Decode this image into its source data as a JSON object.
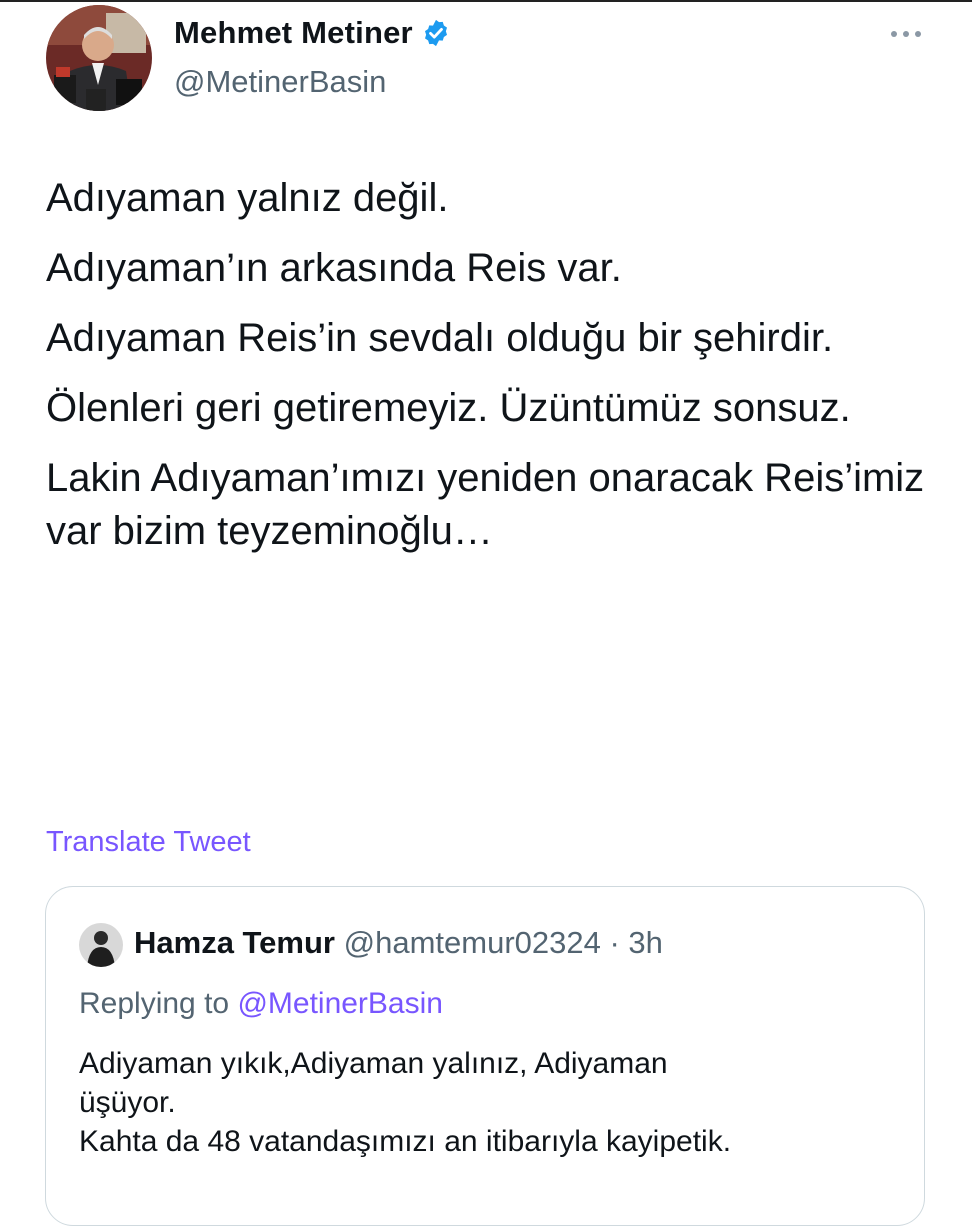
{
  "tweet": {
    "author": {
      "display_name": "Mehmet Metiner",
      "handle": "@MetinerBasin",
      "verified_icon": "verified-badge-icon",
      "verified_color": "#1d9bf0"
    },
    "more_icon": "more-horizontal-icon",
    "paragraphs": [
      "Adıyaman yalnız değil.",
      "Adıyaman’ın arkasında Reis var.",
      "Adıyaman Reis’in sevdalı olduğu bir şehirdir.",
      "Ölenleri geri getiremeyiz. Üzüntümüz sonsuz.",
      "Lakin Adıyaman’ımızı yeniden onaracak Reis’imiz var bizim teyzeminoğlu…"
    ],
    "translate_label": "Translate Tweet",
    "accent_color": "#7856ff"
  },
  "quoted": {
    "display_name": "Hamza Temur",
    "handle": "@hamtemur02324",
    "separator": " · ",
    "time": "3h",
    "replying_prefix": "Replying to ",
    "replying_to": "@MetinerBasin",
    "body_lines": [
      "Adiyaman yıkık,Adiyaman yalınız, Adiyaman",
      "üşüyor.",
      "Kahta da 48 vatandaşımızı an itibarıyla kayipetik."
    ]
  }
}
